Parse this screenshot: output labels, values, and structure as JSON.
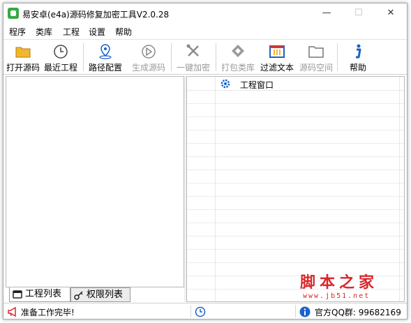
{
  "window": {
    "title": "易安卓(e4a)源码修复加密工具V2.0.28",
    "controls": {
      "minimize": "—",
      "maximize": "☐",
      "close": "✕"
    }
  },
  "menu": [
    "程序",
    "类库",
    "工程",
    "设置",
    "帮助"
  ],
  "toolbar": [
    {
      "label": "打开源码",
      "icon": "folder-icon",
      "enabled": true
    },
    {
      "label": "最近工程",
      "icon": "clock-icon",
      "enabled": true
    },
    {
      "label": "路径配置",
      "icon": "location-pin-icon",
      "enabled": true
    },
    {
      "label": "生成源码",
      "icon": "play-icon",
      "enabled": false
    },
    {
      "label": "一键加密",
      "icon": "tools-icon",
      "enabled": false
    },
    {
      "label": "打包类库",
      "icon": "package-icon",
      "enabled": false
    },
    {
      "label": "过滤文本",
      "icon": "filter-text-icon",
      "enabled": true
    },
    {
      "label": "源码空间",
      "icon": "folder-outline-icon",
      "enabled": false
    },
    {
      "label": "帮助",
      "icon": "info-icon",
      "enabled": true
    }
  ],
  "left_tabs": [
    {
      "label": "工程列表",
      "active": true
    },
    {
      "label": "权限列表",
      "active": false
    }
  ],
  "right_panel": {
    "title": "工程窗口"
  },
  "status": {
    "message": "准备工作完毕!",
    "qq_group": "官方QQ群: 99682169"
  },
  "watermark": {
    "text": "脚本之家",
    "url": "www.jb51.net"
  },
  "colors": {
    "accent_blue": "#1a63c9",
    "status_red": "#d9262b",
    "disabled": "#9a9a9a"
  }
}
